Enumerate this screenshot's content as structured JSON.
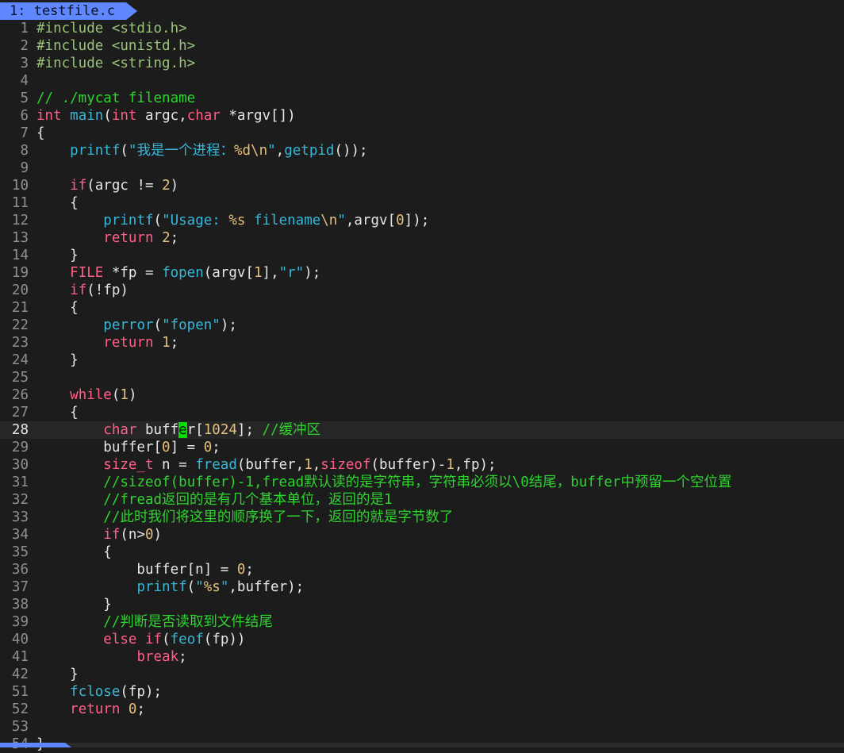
{
  "tab": {
    "label": "1: testfile.c"
  },
  "colors": {
    "background": "#1c1c1c",
    "tab_active": "#5f87ff",
    "preproc": "#98c379",
    "type_keyword": "#ff5f87",
    "function_string": "#36b7d7",
    "number": "#e5c07b",
    "comment": "#2dd52d",
    "cursor": "#00e000"
  },
  "lines": [
    {
      "n": "1",
      "tokens": [
        [
          "pp",
          "#include <stdio.h>"
        ]
      ]
    },
    {
      "n": "2",
      "tokens": [
        [
          "pp",
          "#include <unistd.h>"
        ]
      ]
    },
    {
      "n": "3",
      "tokens": [
        [
          "pp",
          "#include <string.h>"
        ]
      ]
    },
    {
      "n": "4",
      "tokens": []
    },
    {
      "n": "5",
      "tokens": [
        [
          "cm",
          "// ./mycat filename"
        ]
      ]
    },
    {
      "n": "6",
      "tokens": [
        [
          "ty",
          "int"
        ],
        [
          "tx",
          " "
        ],
        [
          "fn",
          "main"
        ],
        [
          "tx",
          "("
        ],
        [
          "ty",
          "int"
        ],
        [
          "tx",
          " argc,"
        ],
        [
          "ty",
          "char"
        ],
        [
          "tx",
          " *argv[])"
        ]
      ]
    },
    {
      "n": "7",
      "tokens": [
        [
          "tx",
          "{"
        ]
      ]
    },
    {
      "n": "8",
      "tokens": [
        [
          "tx",
          "    "
        ],
        [
          "fn",
          "printf"
        ],
        [
          "tx",
          "("
        ],
        [
          "st",
          "\"我是一个进程："
        ],
        [
          "nu",
          "%d\\n"
        ],
        [
          "st",
          "\""
        ],
        [
          "tx",
          ","
        ],
        [
          "fn",
          "getpid"
        ],
        [
          "tx",
          "());"
        ]
      ]
    },
    {
      "n": "9",
      "tokens": []
    },
    {
      "n": "10",
      "tokens": [
        [
          "tx",
          "    "
        ],
        [
          "kw",
          "if"
        ],
        [
          "tx",
          "(argc != "
        ],
        [
          "nu",
          "2"
        ],
        [
          "tx",
          ")"
        ]
      ]
    },
    {
      "n": "11",
      "tokens": [
        [
          "tx",
          "    {"
        ]
      ]
    },
    {
      "n": "12",
      "tokens": [
        [
          "tx",
          "        "
        ],
        [
          "fn",
          "printf"
        ],
        [
          "tx",
          "("
        ],
        [
          "st",
          "\"Usage: "
        ],
        [
          "nu",
          "%s"
        ],
        [
          "st",
          " filename"
        ],
        [
          "nu",
          "\\n"
        ],
        [
          "st",
          "\""
        ],
        [
          "tx",
          ",argv["
        ],
        [
          "nu",
          "0"
        ],
        [
          "tx",
          "]);"
        ]
      ]
    },
    {
      "n": "13",
      "tokens": [
        [
          "tx",
          "        "
        ],
        [
          "kw",
          "return"
        ],
        [
          "tx",
          " "
        ],
        [
          "nu",
          "2"
        ],
        [
          "tx",
          ";"
        ]
      ]
    },
    {
      "n": "14",
      "tokens": [
        [
          "tx",
          "    }"
        ]
      ],
      "fold_after": true
    },
    {
      "n": "19",
      "tokens": [
        [
          "tx",
          "    "
        ],
        [
          "ty",
          "FILE"
        ],
        [
          "tx",
          " *fp = "
        ],
        [
          "fn",
          "fopen"
        ],
        [
          "tx",
          "(argv["
        ],
        [
          "nu",
          "1"
        ],
        [
          "tx",
          "],"
        ],
        [
          "st",
          "\"r\""
        ],
        [
          "tx",
          ");"
        ]
      ]
    },
    {
      "n": "20",
      "tokens": [
        [
          "tx",
          "    "
        ],
        [
          "kw",
          "if"
        ],
        [
          "tx",
          "(!fp)"
        ]
      ]
    },
    {
      "n": "21",
      "tokens": [
        [
          "tx",
          "    {"
        ]
      ]
    },
    {
      "n": "22",
      "tokens": [
        [
          "tx",
          "        "
        ],
        [
          "fn",
          "perror"
        ],
        [
          "tx",
          "("
        ],
        [
          "st",
          "\"fopen\""
        ],
        [
          "tx",
          ");"
        ]
      ]
    },
    {
      "n": "23",
      "tokens": [
        [
          "tx",
          "        "
        ],
        [
          "kw",
          "return"
        ],
        [
          "tx",
          " "
        ],
        [
          "nu",
          "1"
        ],
        [
          "tx",
          ";"
        ]
      ]
    },
    {
      "n": "24",
      "tokens": [
        [
          "tx",
          "    }"
        ]
      ]
    },
    {
      "n": "25",
      "tokens": []
    },
    {
      "n": "26",
      "tokens": [
        [
          "tx",
          "    "
        ],
        [
          "kw",
          "while"
        ],
        [
          "tx",
          "("
        ],
        [
          "nu",
          "1"
        ],
        [
          "tx",
          ")"
        ]
      ]
    },
    {
      "n": "27",
      "tokens": [
        [
          "tx",
          "    {"
        ]
      ]
    },
    {
      "n": "28",
      "cursorline": true,
      "tokens": [
        [
          "tx",
          "        "
        ],
        [
          "ty",
          "char"
        ],
        [
          "tx",
          " buff"
        ],
        [
          "cur",
          "e"
        ],
        [
          "tx",
          "r["
        ],
        [
          "nu",
          "1024"
        ],
        [
          "tx",
          "]; "
        ],
        [
          "cm",
          "//缓冲区"
        ]
      ]
    },
    {
      "n": "29",
      "tokens": [
        [
          "tx",
          "        buffer["
        ],
        [
          "nu",
          "0"
        ],
        [
          "tx",
          "] = "
        ],
        [
          "nu",
          "0"
        ],
        [
          "tx",
          ";"
        ]
      ]
    },
    {
      "n": "30",
      "tokens": [
        [
          "tx",
          "        "
        ],
        [
          "ty",
          "size_t"
        ],
        [
          "tx",
          " n = "
        ],
        [
          "fn",
          "fread"
        ],
        [
          "tx",
          "(buffer,"
        ],
        [
          "nu",
          "1"
        ],
        [
          "tx",
          ","
        ],
        [
          "kw",
          "sizeof"
        ],
        [
          "tx",
          "(buffer)-"
        ],
        [
          "nu",
          "1"
        ],
        [
          "tx",
          ",fp);"
        ]
      ]
    },
    {
      "n": "31",
      "tokens": [
        [
          "tx",
          "        "
        ],
        [
          "cm",
          "//sizeof(buffer)-1,fread默认读的是字符串，字符串必须以\\0结尾，buffer中预留一个空位置"
        ]
      ]
    },
    {
      "n": "32",
      "tokens": [
        [
          "tx",
          "        "
        ],
        [
          "cm",
          "//fread返回的是有几个基本单位，返回的是1"
        ]
      ]
    },
    {
      "n": "33",
      "tokens": [
        [
          "tx",
          "        "
        ],
        [
          "cm",
          "//此时我们将这里的顺序换了一下，返回的就是字节数了"
        ]
      ]
    },
    {
      "n": "34",
      "tokens": [
        [
          "tx",
          "        "
        ],
        [
          "kw",
          "if"
        ],
        [
          "tx",
          "(n>"
        ],
        [
          "nu",
          "0"
        ],
        [
          "tx",
          ")"
        ]
      ]
    },
    {
      "n": "35",
      "tokens": [
        [
          "tx",
          "        {"
        ]
      ]
    },
    {
      "n": "36",
      "tokens": [
        [
          "tx",
          "            buffer[n] = "
        ],
        [
          "nu",
          "0"
        ],
        [
          "tx",
          ";"
        ]
      ]
    },
    {
      "n": "37",
      "tokens": [
        [
          "tx",
          "            "
        ],
        [
          "fn",
          "printf"
        ],
        [
          "tx",
          "("
        ],
        [
          "st",
          "\""
        ],
        [
          "nu",
          "%s"
        ],
        [
          "st",
          "\""
        ],
        [
          "tx",
          ",buffer);"
        ]
      ]
    },
    {
      "n": "38",
      "tokens": [
        [
          "tx",
          "        }"
        ]
      ]
    },
    {
      "n": "39",
      "tokens": [
        [
          "tx",
          "        "
        ],
        [
          "cm",
          "//判断是否读取到文件结尾"
        ]
      ]
    },
    {
      "n": "40",
      "tokens": [
        [
          "tx",
          "        "
        ],
        [
          "kw",
          "else"
        ],
        [
          "tx",
          " "
        ],
        [
          "kw",
          "if"
        ],
        [
          "tx",
          "("
        ],
        [
          "fn",
          "feof"
        ],
        [
          "tx",
          "(fp))"
        ]
      ]
    },
    {
      "n": "41",
      "tokens": [
        [
          "tx",
          "            "
        ],
        [
          "kw",
          "break"
        ],
        [
          "tx",
          ";"
        ]
      ]
    },
    {
      "n": "42",
      "tokens": [
        [
          "tx",
          "    }"
        ]
      ],
      "fold_after": true
    },
    {
      "n": "51",
      "tokens": [
        [
          "tx",
          "    "
        ],
        [
          "fn",
          "fclose"
        ],
        [
          "tx",
          "(fp);"
        ]
      ]
    },
    {
      "n": "52",
      "tokens": [
        [
          "tx",
          "    "
        ],
        [
          "kw",
          "return"
        ],
        [
          "tx",
          " "
        ],
        [
          "nu",
          "0"
        ],
        [
          "tx",
          ";"
        ]
      ]
    },
    {
      "n": "53",
      "tokens": []
    },
    {
      "n": "54",
      "tokens": [
        [
          "tx",
          "}"
        ]
      ]
    }
  ]
}
